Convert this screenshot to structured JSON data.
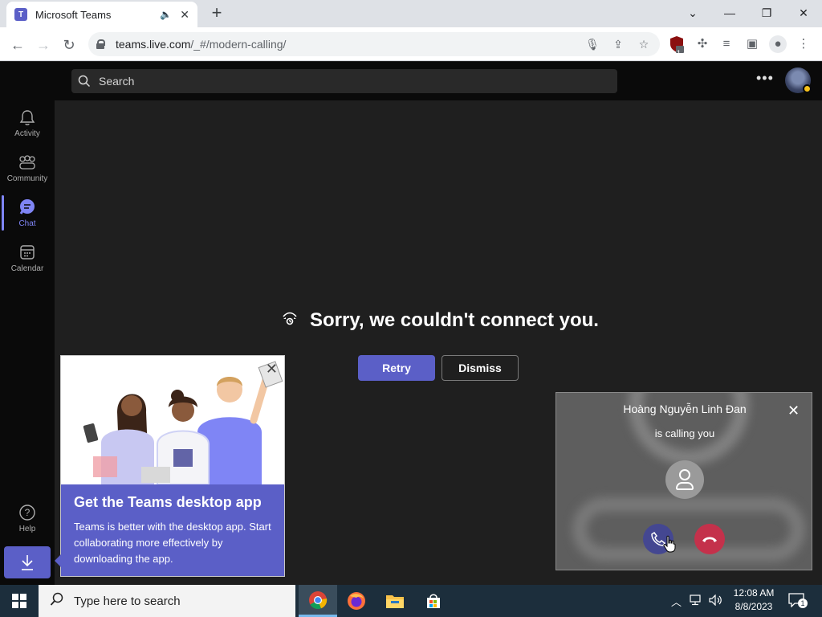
{
  "browser": {
    "tab_title": "Microsoft Teams",
    "url_host": "teams.live.com",
    "url_path": "/_#/modern-calling/",
    "extension_badge": "1"
  },
  "teams": {
    "search_placeholder": "Search",
    "rail": [
      {
        "label": "Activity",
        "icon": "bell-icon"
      },
      {
        "label": "Community",
        "icon": "community-icon"
      },
      {
        "label": "Chat",
        "icon": "chat-icon",
        "active": true
      },
      {
        "label": "Calendar",
        "icon": "calendar-icon"
      },
      {
        "label": "Help",
        "icon": "help-icon"
      }
    ],
    "error": {
      "title": "Sorry, we couldn't connect you.",
      "retry_label": "Retry",
      "dismiss_label": "Dismiss"
    },
    "promo": {
      "title": "Get the Teams desktop app",
      "text": "Teams is better with the desktop app. Start collaborating more effectively by downloading the app."
    },
    "call": {
      "caller_name": "Hoàng Nguyễn Linh Đan",
      "subtitle": "is calling you"
    }
  },
  "taskbar": {
    "search_placeholder": "Type here to search",
    "time": "12:08 AM",
    "date": "8/8/2023",
    "notification_count": "1"
  },
  "colors": {
    "accent": "#5b5fc7",
    "decline": "#c4314b",
    "accept": "#444791"
  }
}
